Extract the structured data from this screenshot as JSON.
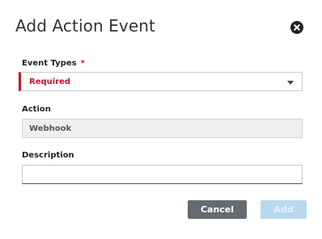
{
  "dialog": {
    "title": "Add Action Event",
    "close_icon": "close-circle-icon"
  },
  "event_types": {
    "label": "Event Types",
    "required_marker": "*",
    "value": "Required"
  },
  "action": {
    "label": "Action",
    "value": "Webhook"
  },
  "description": {
    "label": "Description",
    "value": ""
  },
  "buttons": {
    "cancel": "Cancel",
    "add": "Add"
  },
  "colors": {
    "error": "#c8102e",
    "cancel_bg": "#666b72",
    "add_bg_disabled": "#b7d8ee"
  }
}
